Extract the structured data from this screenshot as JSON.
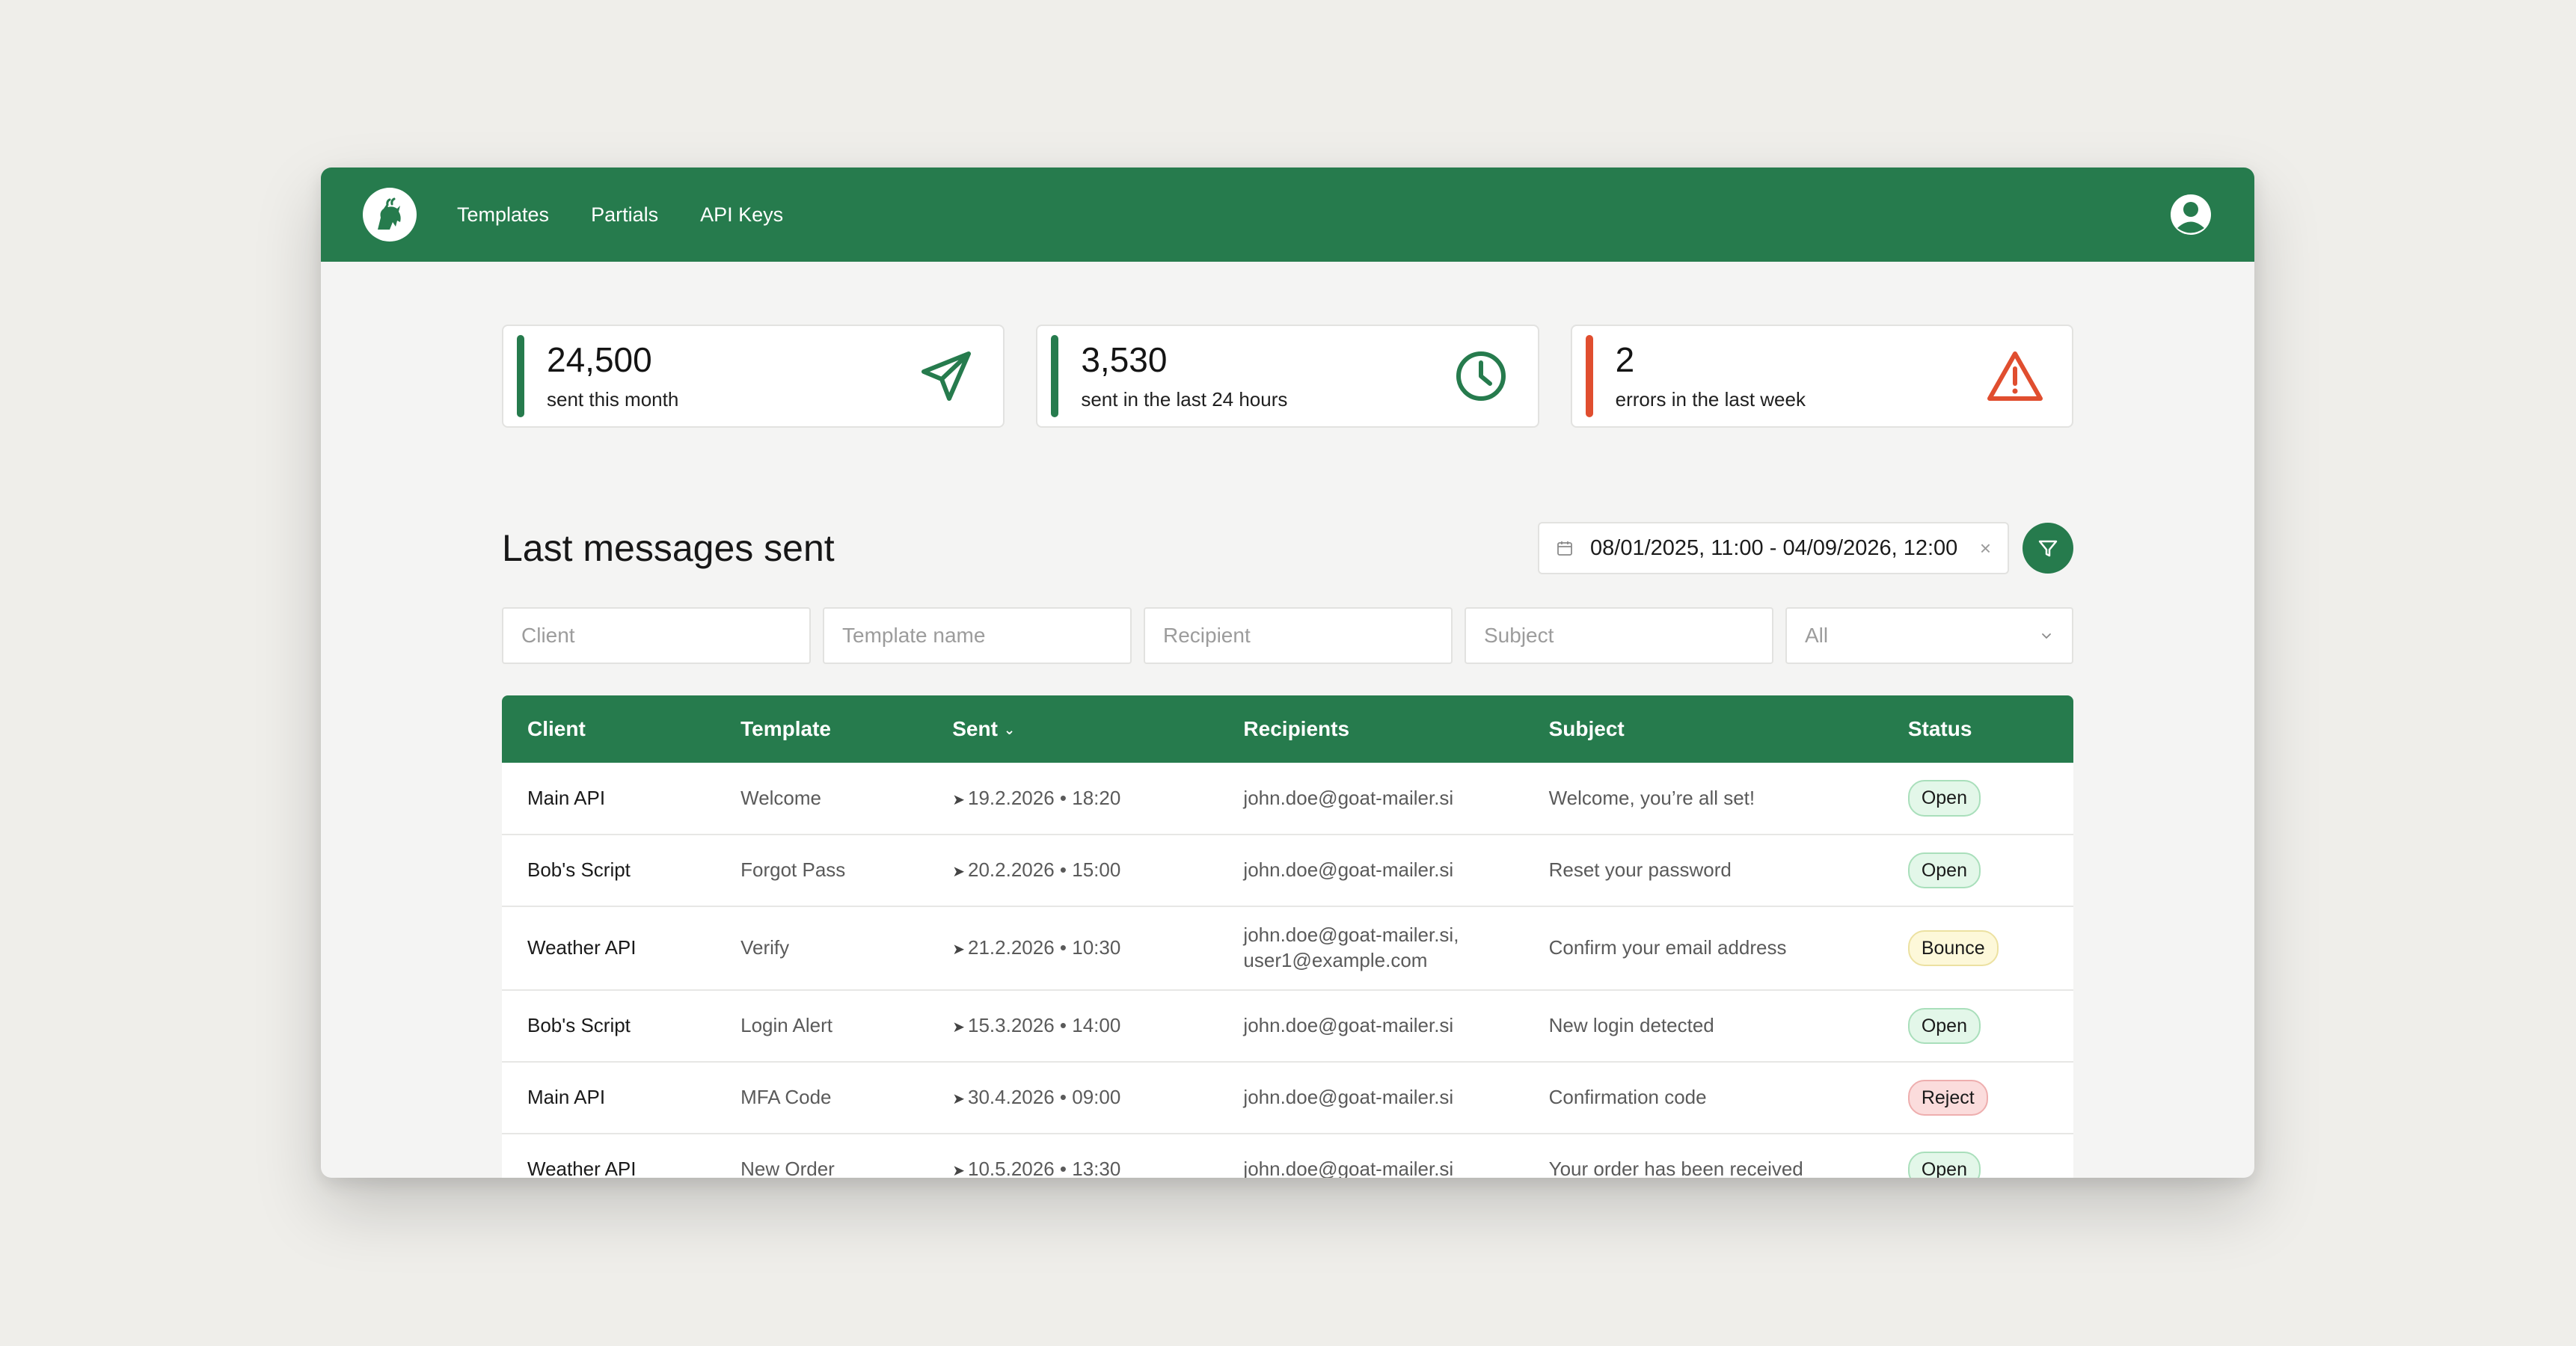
{
  "nav": {
    "links": [
      "Templates",
      "Partials",
      "API Keys"
    ]
  },
  "stats": [
    {
      "value": "24,500",
      "label": "sent this month",
      "icon": "send-icon",
      "accent": "#267b4d"
    },
    {
      "value": "3,530",
      "label": "sent in the last 24 hours",
      "icon": "clock-icon",
      "accent": "#267b4d"
    },
    {
      "value": "2",
      "label": "errors in the last week",
      "icon": "warning-icon",
      "accent": "#e04e2f"
    }
  ],
  "section": {
    "title": "Last messages sent",
    "date_range": "08/01/2025, 11:00 - 04/09/2026, 12:00",
    "clear": "×"
  },
  "filters": {
    "client_placeholder": "Client",
    "template_placeholder": "Template name",
    "recipient_placeholder": "Recipient",
    "subject_placeholder": "Subject",
    "status_value": "All"
  },
  "table": {
    "columns": [
      "Client",
      "Template",
      "Sent",
      "Recipients",
      "Subject",
      "Status"
    ],
    "rows": [
      {
        "client": "Main API",
        "template": "Welcome",
        "sent": "19.2.2026 • 18:20",
        "recipients": "john.doe@goat-mailer.si",
        "recipients2": "",
        "subject": "Welcome, you’re all set!",
        "status": "Open"
      },
      {
        "client": "Bob's Script",
        "template": "Forgot Pass",
        "sent": "20.2.2026 • 15:00",
        "recipients": "john.doe@goat-mailer.si",
        "recipients2": "",
        "subject": "Reset your password",
        "status": "Open"
      },
      {
        "client": "Weather API",
        "template": "Verify",
        "sent": "21.2.2026 • 10:30",
        "recipients": "john.doe@goat-mailer.si,",
        "recipients2": "user1@example.com",
        "subject": "Confirm your email address",
        "status": "Bounce"
      },
      {
        "client": "Bob's Script",
        "template": "Login Alert",
        "sent": "15.3.2026 • 14:00",
        "recipients": "john.doe@goat-mailer.si",
        "recipients2": "",
        "subject": "New login detected",
        "status": "Open"
      },
      {
        "client": "Main API",
        "template": "MFA Code",
        "sent": "30.4.2026 • 09:00",
        "recipients": "john.doe@goat-mailer.si",
        "recipients2": "",
        "subject": "Confirmation code",
        "status": "Reject"
      },
      {
        "client": "Weather API",
        "template": "New Order",
        "sent": "10.5.2026 • 13:30",
        "recipients": "john.doe@goat-mailer.si",
        "recipients2": "",
        "subject": "Your order has been received",
        "status": "Open"
      }
    ]
  },
  "colors": {
    "brand": "#267b4d",
    "error": "#e04e2f"
  }
}
